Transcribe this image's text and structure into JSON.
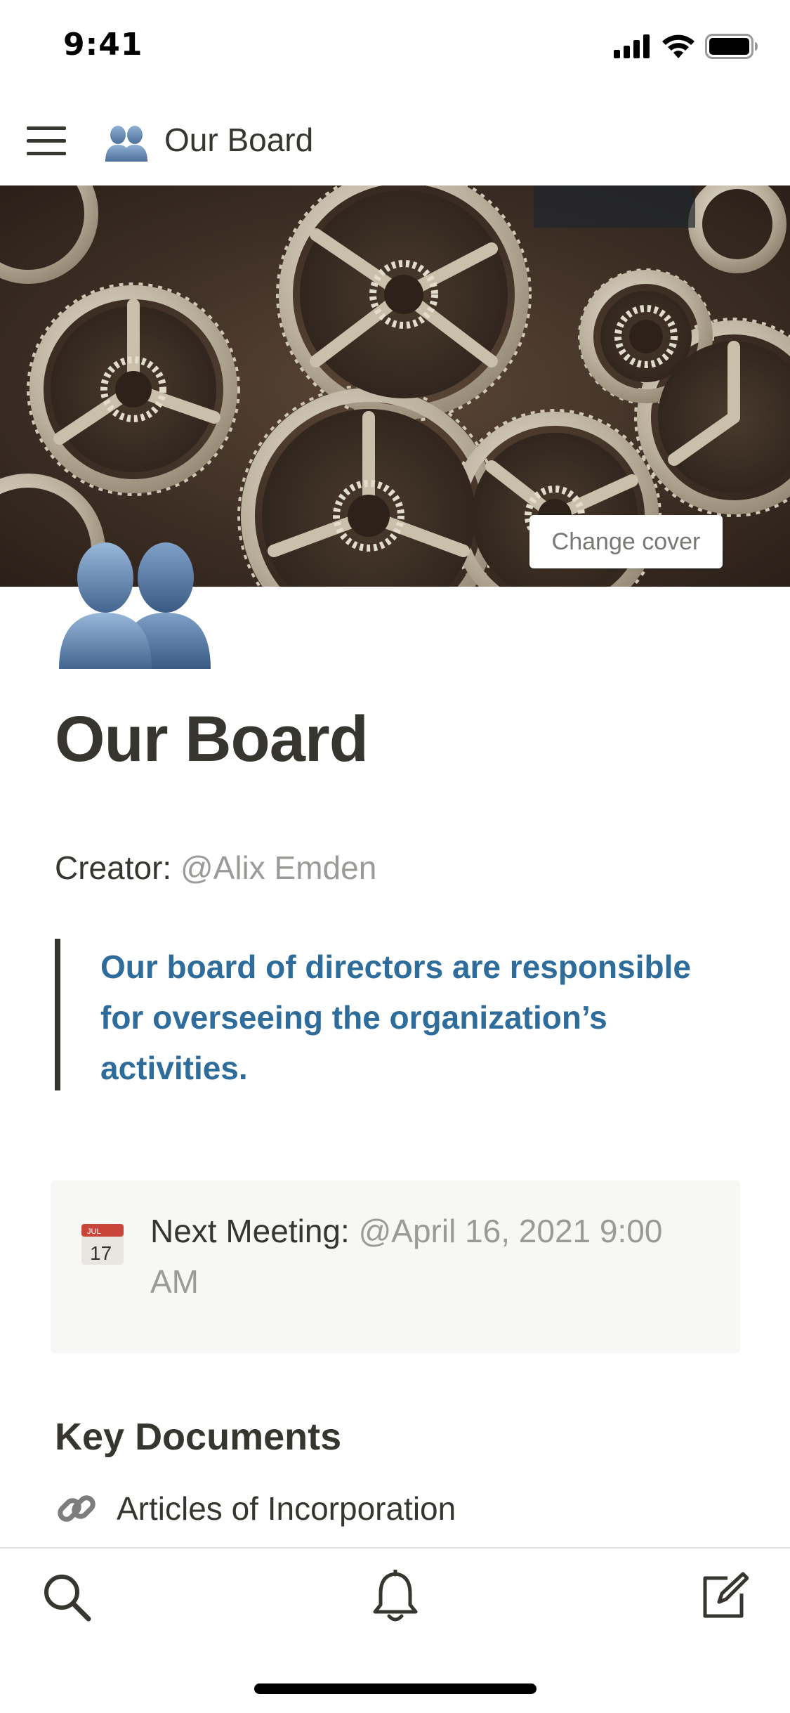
{
  "status_bar": {
    "time": "9:41",
    "icons": [
      "cellular-signal-icon",
      "wifi-icon",
      "battery-icon"
    ]
  },
  "nav": {
    "menu_icon": "hamburger-menu-icon",
    "page_icon": "busts-in-silhouette-icon",
    "title": "Our Board"
  },
  "cover": {
    "image": "gears-cover-image",
    "change_cover_label": "Change cover"
  },
  "page": {
    "icon": "busts-in-silhouette-icon",
    "title": "Our Board",
    "creator_label": "Creator:",
    "creator_mention": "@Alix Emden",
    "quote": "Our board of directors are responsible for overseeing the organization’s activities.",
    "callout": {
      "icon": "calendar-icon",
      "icon_month": "JUL",
      "icon_day": "17",
      "label": "Next Meeting:",
      "mention": "@April 16, 2021 9:00 AM"
    },
    "section_heading": "Key Documents",
    "documents": [
      {
        "icon": "link-icon",
        "label": "Articles of Incorporation"
      }
    ]
  },
  "bottom_bar": {
    "tabs": [
      "search-icon",
      "notification-bell-icon",
      "compose-icon"
    ]
  },
  "colors": {
    "text": "#37352f",
    "muted": "#9b9a97",
    "quote": "#2e6c9b",
    "callout_bg": "#f7f7f5"
  }
}
